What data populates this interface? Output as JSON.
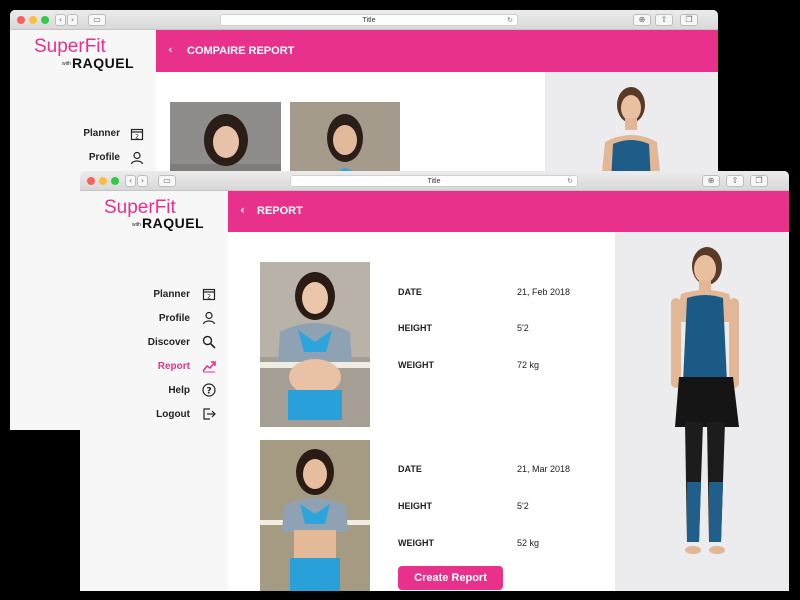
{
  "browser": {
    "url_title": "Title"
  },
  "brand": {
    "line1": "SuperFit",
    "with": "with",
    "line2": "RAQUEL"
  },
  "back_window": {
    "header_title": "COMPAIRE REPORT",
    "nav": [
      {
        "label": "Planner"
      },
      {
        "label": "Profile"
      }
    ]
  },
  "front_window": {
    "header_title": "REPORT",
    "nav": [
      {
        "label": "Planner",
        "icon": "calendar-icon"
      },
      {
        "label": "Profile",
        "icon": "user-icon"
      },
      {
        "label": "Discover",
        "icon": "search-icon"
      },
      {
        "label": "Report",
        "icon": "trending-up-icon",
        "active": true
      },
      {
        "label": "Help",
        "icon": "help-icon"
      },
      {
        "label": "Logout",
        "icon": "logout-icon"
      }
    ],
    "reports": [
      {
        "date_label": "DATE",
        "date": "21, Feb 2018",
        "height_label": "HEIGHT",
        "height": "5'2",
        "weight_label": "WEIGHT",
        "weight": "72 kg"
      },
      {
        "date_label": "DATE",
        "date": "21, Mar 2018",
        "height_label": "HEIGHT",
        "height": "5'2",
        "weight_label": "WEIGHT",
        "weight": "52 kg"
      }
    ],
    "create_button": "Create Report"
  },
  "colors": {
    "accent": "#e8318a",
    "nav_text": "#222222",
    "sidebar_bg": "#f7f7f7"
  }
}
